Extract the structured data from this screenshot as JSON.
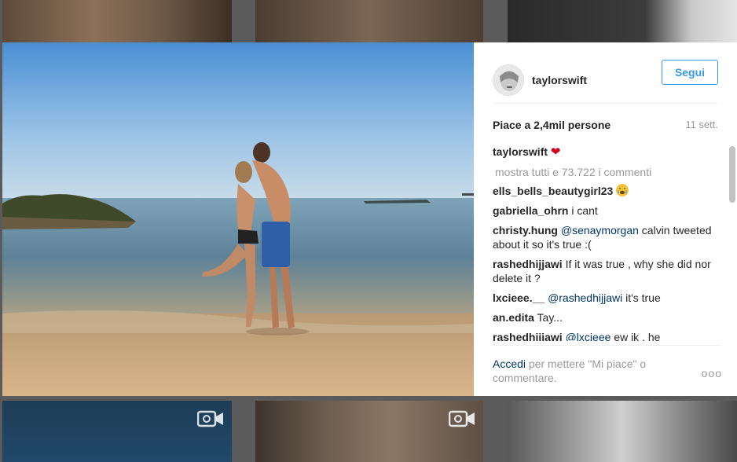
{
  "post": {
    "username": "taylorswift",
    "follow_label": "Segui",
    "likes_text": "Piace a 2,4mil persone",
    "time_ago": "11 sett.",
    "caption_user": "taylorswift",
    "caption_icon": "red-heart",
    "load_more": "mostra tutti e 73.722 i commenti"
  },
  "comments": [
    {
      "user": "ells_bells_beautygirl23",
      "text": "",
      "emoji": "crying-face"
    },
    {
      "user": "gabriella_ohrn",
      "text": "i cant"
    },
    {
      "user": "christy.hung",
      "mention": "@senaymorgan",
      "text": "calvin tweeted about it so it's true :("
    },
    {
      "user": "rashedhijjawi",
      "text": "If it was true , why she did nor delete it ?"
    },
    {
      "user": "lxcieee.__",
      "mention": "@rashedhijjawi",
      "text": "it's true"
    },
    {
      "user": "an.edita",
      "text": "Tay..."
    },
    {
      "user": "rashedhijjawi",
      "mention": "@lxcieee",
      "text": "ew ik , he"
    }
  ],
  "footer": {
    "login_link": "Accedi",
    "login_text": "per mettere \"Mi piace\" o commentare.",
    "more_options": "ooo"
  },
  "colors": {
    "accent": "#3897f0",
    "link": "#003569",
    "muted": "#999999",
    "backdrop": "#5b5b5b"
  }
}
